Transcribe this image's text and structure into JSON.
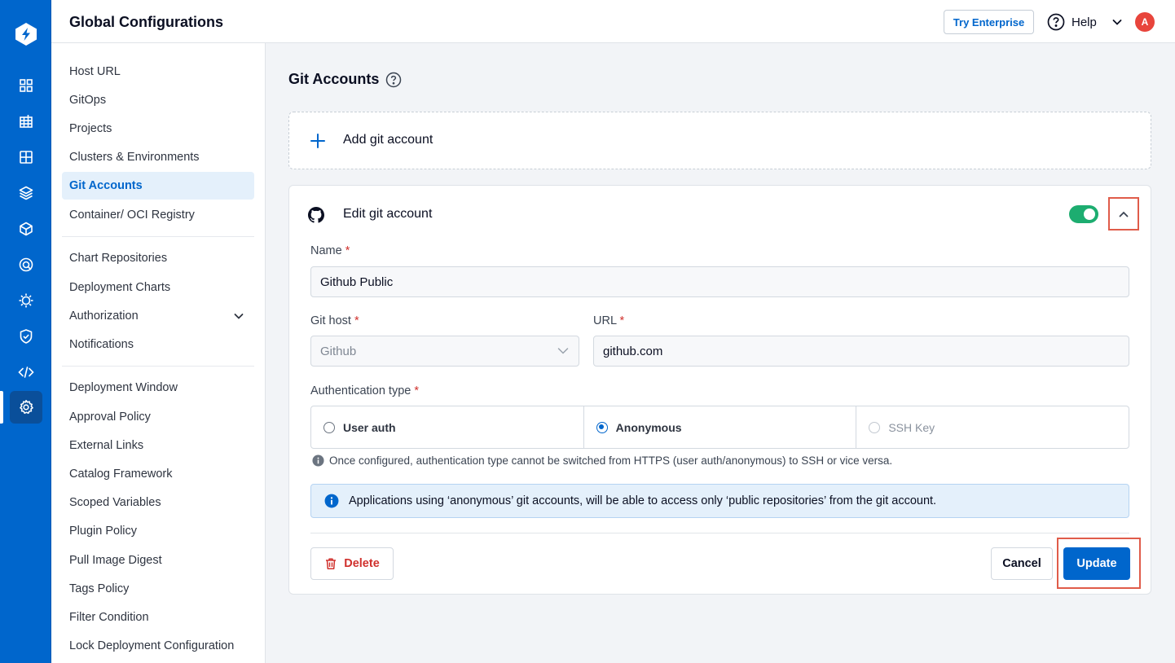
{
  "header": {
    "title": "Global Configurations",
    "try_enterprise": "Try Enterprise",
    "help": "Help",
    "avatar_initial": "A"
  },
  "rail": {
    "icons": [
      "logo-icon",
      "apps-grid-icon",
      "chart-grid-icon",
      "resource-grid-icon",
      "stack-icon",
      "cube-icon",
      "security-scan-icon",
      "bug-gear-icon",
      "shield-check-icon",
      "code-icon",
      "settings-gear-icon"
    ],
    "active": "settings-gear-icon"
  },
  "sidebar": {
    "groups": [
      [
        "Host URL",
        "GitOps",
        "Projects",
        "Clusters & Environments",
        "Git Accounts",
        "Container/ OCI Registry"
      ],
      [
        "Chart Repositories",
        "Deployment Charts",
        "Authorization",
        "Notifications"
      ],
      [
        "Deployment Window",
        "Approval Policy",
        "External Links",
        "Catalog Framework",
        "Scoped Variables",
        "Plugin Policy",
        "Pull Image Digest",
        "Tags Policy",
        "Filter Condition",
        "Lock Deployment Configuration"
      ]
    ],
    "active": "Git Accounts"
  },
  "main": {
    "title": "Git Accounts",
    "add_label": "Add git account",
    "edit": {
      "title": "Edit git account",
      "toggle_on": true,
      "name_label": "Name",
      "name_value": "Github Public",
      "git_host_label": "Git host",
      "git_host_value": "Github",
      "url_label": "URL",
      "url_value": "github.com",
      "auth_label": "Authentication type",
      "auth_options": [
        "User auth",
        "Anonymous",
        "SSH Key"
      ],
      "auth_selected": "Anonymous",
      "note": "Once configured, authentication type cannot be switched from HTTPS (user auth/anonymous) to SSH or vice versa.",
      "banner": "Applications using ‘anonymous’ git accounts, will be able to access only ‘public repositories’ from the git account.",
      "delete_label": "Delete",
      "cancel_label": "Cancel",
      "update_label": "Update"
    }
  },
  "colors": {
    "brand": "#0066cc",
    "toggle_on": "#1dad70",
    "danger": "#d0312d",
    "highlight": "#e05c4a"
  }
}
